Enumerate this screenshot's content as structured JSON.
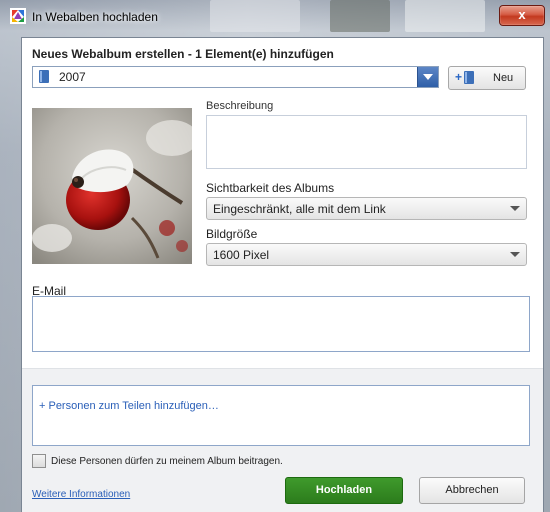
{
  "window": {
    "title": "In Webalben hochladen",
    "close_label": "x"
  },
  "dialog": {
    "heading": "Neues Webalbum erstellen - 1 Element(e) hinzufügen",
    "album_select": {
      "value": "2007"
    },
    "new_button_label": "Neu",
    "description": {
      "label": "Beschreibung",
      "value": ""
    },
    "visibility": {
      "label": "Sichtbarkeit des Albums",
      "value": "Eingeschränkt, alle mit dem Link"
    },
    "image_size": {
      "label": "Bildgröße",
      "value": "1600 Pixel"
    },
    "email": {
      "label": "E-Mail",
      "value": ""
    },
    "share_link": "+ Personen zum Teilen hinzufügen…",
    "contribute_checkbox": {
      "label": "Diese Personen dürfen zu meinem Album beitragen.",
      "checked": false
    },
    "more_info_link": "Weitere Informationen",
    "upload_button": "Hochladen",
    "cancel_button": "Abbrechen"
  },
  "colors": {
    "accent_blue": "#2f5fa8",
    "upload_green": "#2c7c1c",
    "close_red": "#c3391f",
    "link_blue": "#2a5fb8"
  },
  "icons": [
    "picasa-app-icon",
    "close-icon",
    "album-book-icon",
    "dropdown-arrow-icon",
    "new-album-icon",
    "chevron-down-icon"
  ]
}
